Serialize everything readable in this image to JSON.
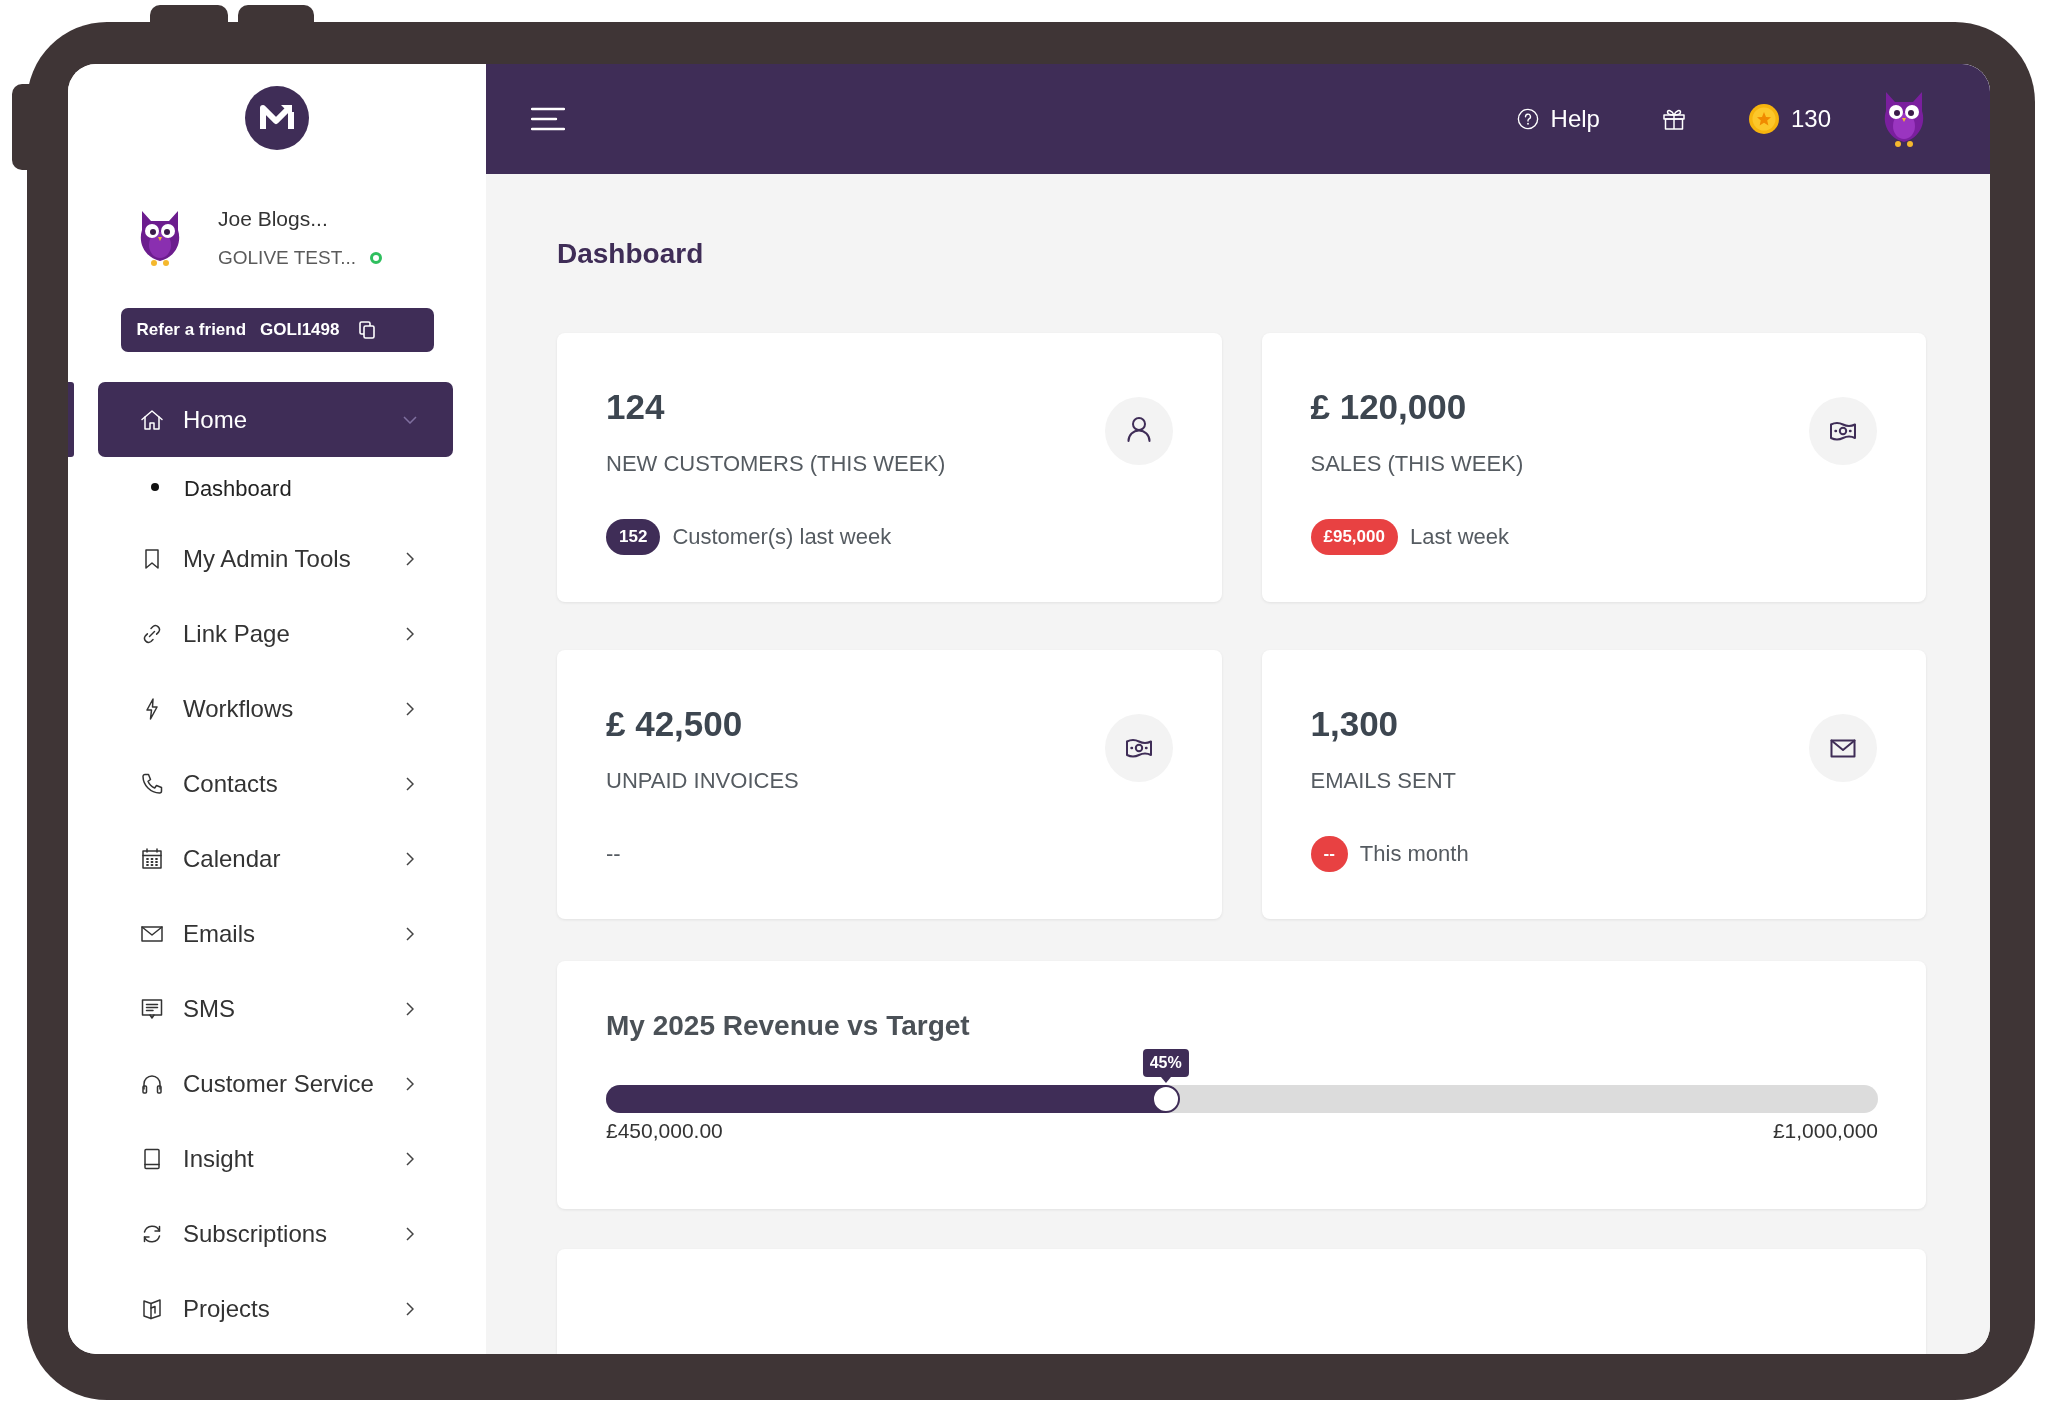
{
  "sidebar": {
    "user": {
      "name": "Joe Blogs...",
      "company": "GOLIVE TEST...",
      "online": true
    },
    "referral": {
      "label": "Refer a friend",
      "code": "GOLI1498"
    },
    "nav": [
      {
        "label": "Home",
        "selected": true,
        "expanded": true,
        "children": [
          {
            "label": "Dashboard",
            "selected": true
          }
        ]
      },
      {
        "label": "My Admin Tools",
        "selected": false,
        "expanded": false
      },
      {
        "label": "Link Page",
        "selected": false,
        "expanded": false
      },
      {
        "label": "Workflows",
        "selected": false,
        "expanded": false
      },
      {
        "label": "Contacts",
        "selected": false,
        "expanded": false
      },
      {
        "label": "Calendar",
        "selected": false,
        "expanded": false
      },
      {
        "label": "Emails",
        "selected": false,
        "expanded": false
      },
      {
        "label": "SMS",
        "selected": false,
        "expanded": false
      },
      {
        "label": "Customer Service",
        "selected": false,
        "expanded": false
      },
      {
        "label": "Insight",
        "selected": false,
        "expanded": false
      },
      {
        "label": "Subscriptions",
        "selected": false,
        "expanded": false
      },
      {
        "label": "Projects",
        "selected": false,
        "expanded": false
      }
    ]
  },
  "top_bar": {
    "help": "Help",
    "coins": "130"
  },
  "page": {
    "title": "Dashboard"
  },
  "stats": [
    {
      "value": "124",
      "label": "NEW CUSTOMERS (THIS WEEK)",
      "badge": {
        "text": "152",
        "color": "#3f2d57"
      },
      "note": "Customer(s) last week"
    },
    {
      "value": "£ 120,000",
      "label": "SALES (THIS WEEK)",
      "badge": {
        "text": "£95,000",
        "color": "#e84142"
      },
      "note": "Last week"
    },
    {
      "value": "£ 42,500",
      "label": "UNPAID INVOICES",
      "note": "--"
    },
    {
      "value": "1,300",
      "label": "EMAILS SENT",
      "badge": {
        "text": "--",
        "color": "#e84142"
      },
      "note": "This month"
    }
  ],
  "revenue": {
    "title": "My 2025 Revenue vs Target",
    "level": 0.44,
    "tooltip": "45%",
    "min_label": "£450,000.00",
    "max_label": "£1,000,000"
  }
}
